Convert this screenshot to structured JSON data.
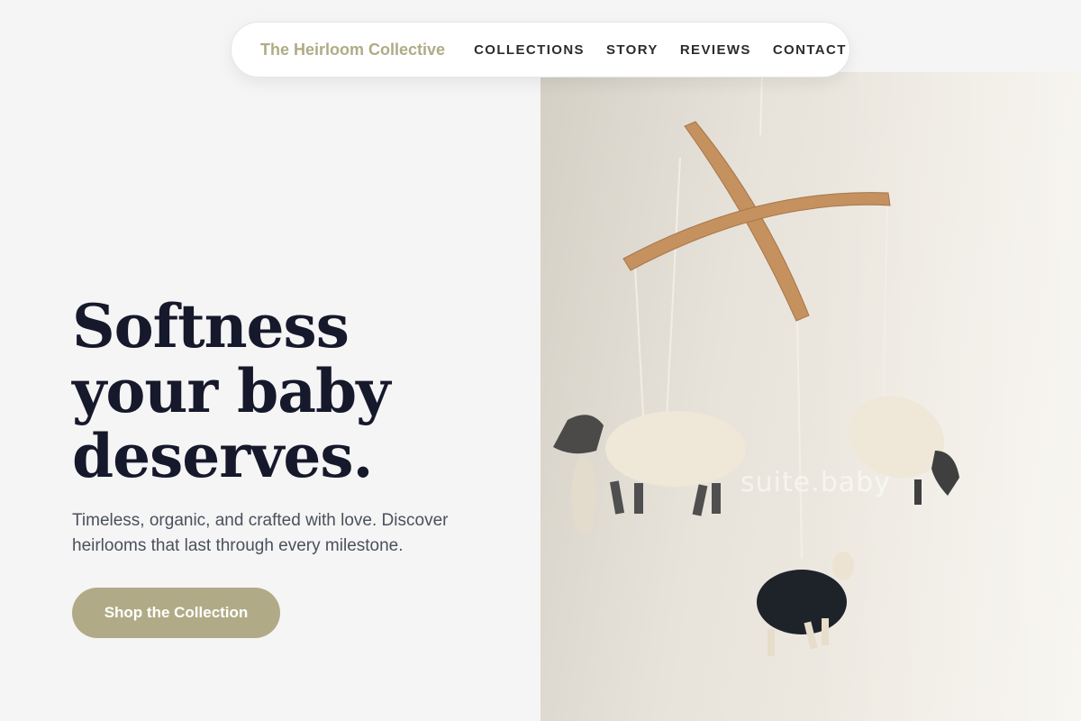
{
  "nav": {
    "brand": "The Heirloom Collective",
    "links": [
      "COLLECTIONS",
      "STORY",
      "REVIEWS",
      "CONTACT"
    ]
  },
  "hero": {
    "headline_lines": [
      "Softness",
      "your baby",
      "deserves."
    ],
    "subtext": "Timeless, organic, and crafted with love. Discover heirlooms that last through every milestone.",
    "cta_label": "Shop the Collection"
  },
  "photo": {
    "subject": "sheep-mobile-photo",
    "watermark": "suite.baby"
  },
  "colors": {
    "accent": "#b0ab86",
    "headline": "#16192b",
    "body_text": "#4a505c",
    "background": "#f5f5f5"
  }
}
